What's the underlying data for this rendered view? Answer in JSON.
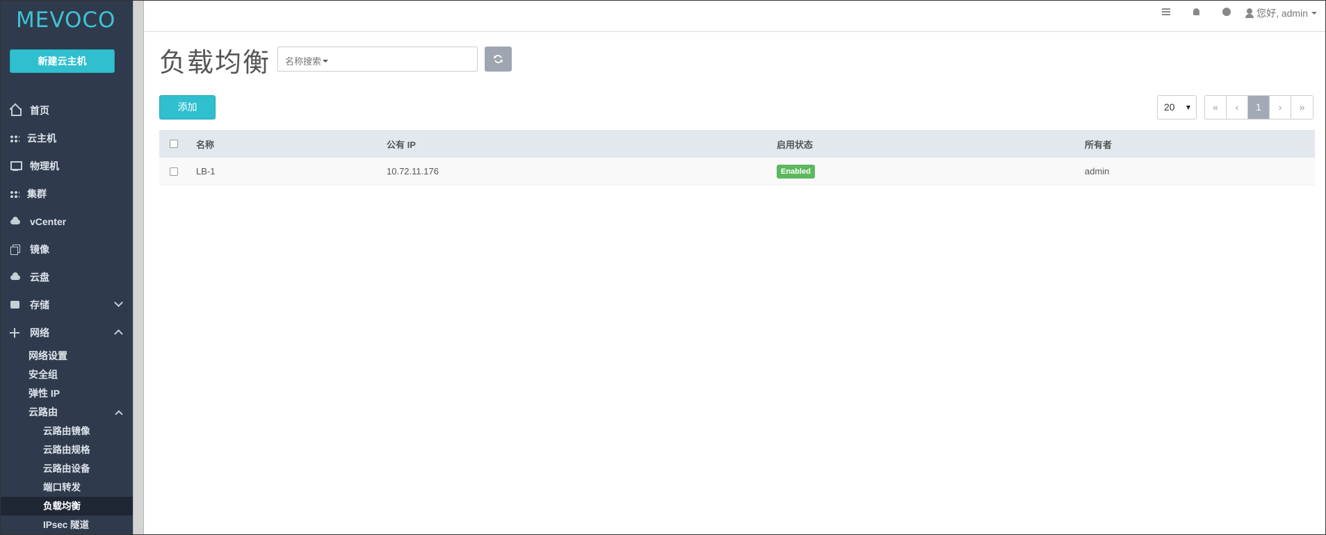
{
  "app": {
    "logo_text": "MEVOCO"
  },
  "sidebar": {
    "new_vm_label": "新建云主机",
    "items": [
      {
        "label": "首页",
        "icon": "home-icon"
      },
      {
        "label": "云主机",
        "icon": "grid-icon"
      },
      {
        "label": "物理机",
        "icon": "monitor-icon"
      },
      {
        "label": "集群",
        "icon": "grid-icon"
      },
      {
        "label": "vCenter",
        "icon": "cloud-icon"
      },
      {
        "label": "镜像",
        "icon": "copy-icon"
      },
      {
        "label": "云盘",
        "icon": "cloud-upload-icon"
      },
      {
        "label": "存储",
        "icon": "hdd-icon"
      },
      {
        "label": "网络",
        "icon": "network-icon"
      }
    ],
    "network_sub": [
      {
        "label": "网络设置"
      },
      {
        "label": "安全组"
      },
      {
        "label": "弹性 IP"
      },
      {
        "label": "云路由"
      }
    ],
    "router_sub": [
      {
        "label": "云路由镜像"
      },
      {
        "label": "云路由规格"
      },
      {
        "label": "云路由设备"
      },
      {
        "label": "端口转发"
      },
      {
        "label": "负载均衡"
      },
      {
        "label": "IPsec 隧道"
      }
    ]
  },
  "topbar": {
    "greeting": "您好, admin"
  },
  "main": {
    "title": "负载均衡",
    "search": {
      "filter_label": "名称搜索",
      "value": ""
    },
    "add_label": "添加",
    "page_size": "20",
    "pager": {
      "first": "«",
      "prev": "‹",
      "current": "1",
      "next": "›",
      "last": "»"
    },
    "table": {
      "headers": {
        "name": "名称",
        "ip": "公有 IP",
        "status": "启用状态",
        "owner": "所有者"
      },
      "rows": [
        {
          "name": "LB-1",
          "ip": "10.72.11.176",
          "status": "Enabled",
          "owner": "admin"
        }
      ]
    }
  },
  "colors": {
    "accent": "#2fbfcf",
    "sidebar_bg": "#2f3b4d",
    "enabled": "#5cb85c"
  }
}
